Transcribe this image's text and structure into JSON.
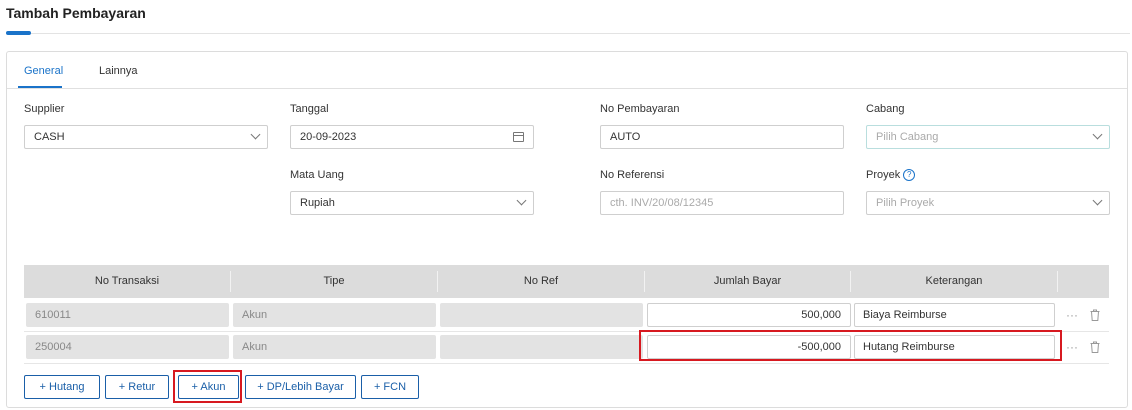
{
  "page": {
    "title": "Tambah Pembayaran"
  },
  "tabs": [
    {
      "label": "General",
      "active": true
    },
    {
      "label": "Lainnya",
      "active": false
    }
  ],
  "form": {
    "supplier": {
      "label": "Supplier",
      "value": "CASH"
    },
    "tanggal": {
      "label": "Tanggal",
      "value": "20-09-2023"
    },
    "no_pembayaran": {
      "label": "No Pembayaran",
      "value": "AUTO"
    },
    "cabang": {
      "label": "Cabang",
      "placeholder": "Pilih Cabang"
    },
    "mata_uang": {
      "label": "Mata Uang",
      "value": "Rupiah"
    },
    "no_referensi": {
      "label": "No Referensi",
      "placeholder": "cth. INV/20/08/12345"
    },
    "proyek": {
      "label": "Proyek",
      "placeholder": "Pilih Proyek",
      "help": "?"
    }
  },
  "table": {
    "headers": [
      "No Transaksi",
      "Tipe",
      "No Ref",
      "Jumlah Bayar",
      "Keterangan"
    ],
    "rows": [
      {
        "no_transaksi": "610011",
        "tipe": "Akun",
        "no_ref": "",
        "jumlah_bayar": "500,000",
        "keterangan": "Biaya Reimburse"
      },
      {
        "no_transaksi": "250004",
        "tipe": "Akun",
        "no_ref": "",
        "jumlah_bayar": "-500,000",
        "keterangan": "Hutang Reimburse"
      }
    ],
    "more_glyph": "···"
  },
  "buttons": {
    "hutang": "+ Hutang",
    "retur": "+ Retur",
    "akun": "+ Akun",
    "dp_lebih_bayar": "+ DP/Lebih Bayar",
    "fcn": "+ FCN"
  },
  "colors": {
    "accent": "#1a73c9",
    "button": "#1a5fa8",
    "highlight": "#d71920"
  }
}
